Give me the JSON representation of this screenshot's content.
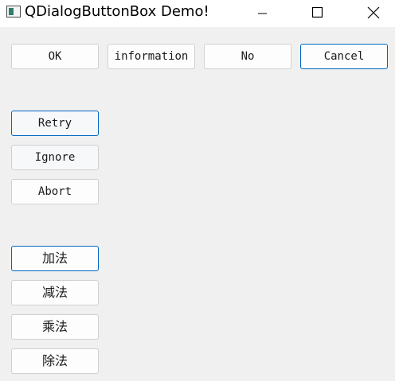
{
  "window": {
    "title": "QDialogButtonBox Demo!",
    "icon": "app-window-icon",
    "controls": [
      "minimize-icon",
      "maximize-icon",
      "close-icon"
    ]
  },
  "button_box_top": {
    "buttons": [
      "OK",
      "information",
      "No",
      "Cancel"
    ]
  },
  "button_box_left_1": {
    "buttons": [
      "Retry",
      "Ignore",
      "Abort"
    ]
  },
  "button_box_left_2": {
    "buttons": [
      "加法",
      "减法",
      "乘法",
      "除法"
    ]
  },
  "colors": {
    "window_bg": "#f0f0f0",
    "titlebar_bg": "#ffffff",
    "default_button_border": "#0067c0",
    "button_border": "#d0d0d0"
  }
}
